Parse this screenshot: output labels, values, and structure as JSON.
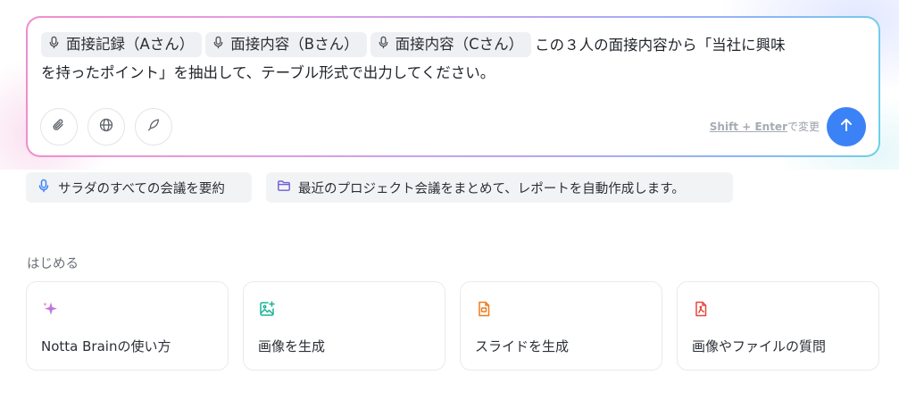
{
  "composer": {
    "chips": [
      {
        "label": "面接記録（Aさん）",
        "icon": "microphone-icon"
      },
      {
        "label": "面接内容（Bさん）",
        "icon": "microphone-icon"
      },
      {
        "label": "面接内容（Cさん）",
        "icon": "microphone-icon"
      }
    ],
    "prompt_line1": "この３人の面接内容から「当社に興味",
    "prompt_line2": "を持ったポイント」を抽出して、テーブル形式で出力してください。",
    "tools": [
      "paperclip-icon",
      "globe-icon",
      "feather-icon"
    ],
    "hint_key": "Shift + Enter",
    "hint_suffix": "で変更",
    "send_icon": "arrow-up-icon"
  },
  "suggestions": [
    {
      "label": "サラダのすべての会議を要約",
      "icon": "microphone-icon"
    },
    {
      "label": "最近のプロジェクト会議をまとめて、レポートを自動作成します。",
      "icon": "folder-icon"
    }
  ],
  "start_section": {
    "title": "はじめる",
    "cards": [
      {
        "label": "Notta Brainの使い方",
        "icon": "sparkle-icon"
      },
      {
        "label": "画像を生成",
        "icon": "image-add-icon"
      },
      {
        "label": "スライドを生成",
        "icon": "slide-doc-icon"
      },
      {
        "label": "画像やファイルの質問",
        "icon": "pdf-file-icon"
      }
    ]
  },
  "colors": {
    "accent": "#3b82f6",
    "border_gradient": [
      "#f08ccd",
      "#b7a6f2",
      "#6fd0e6"
    ],
    "chip_bg": "#eef0f3"
  }
}
